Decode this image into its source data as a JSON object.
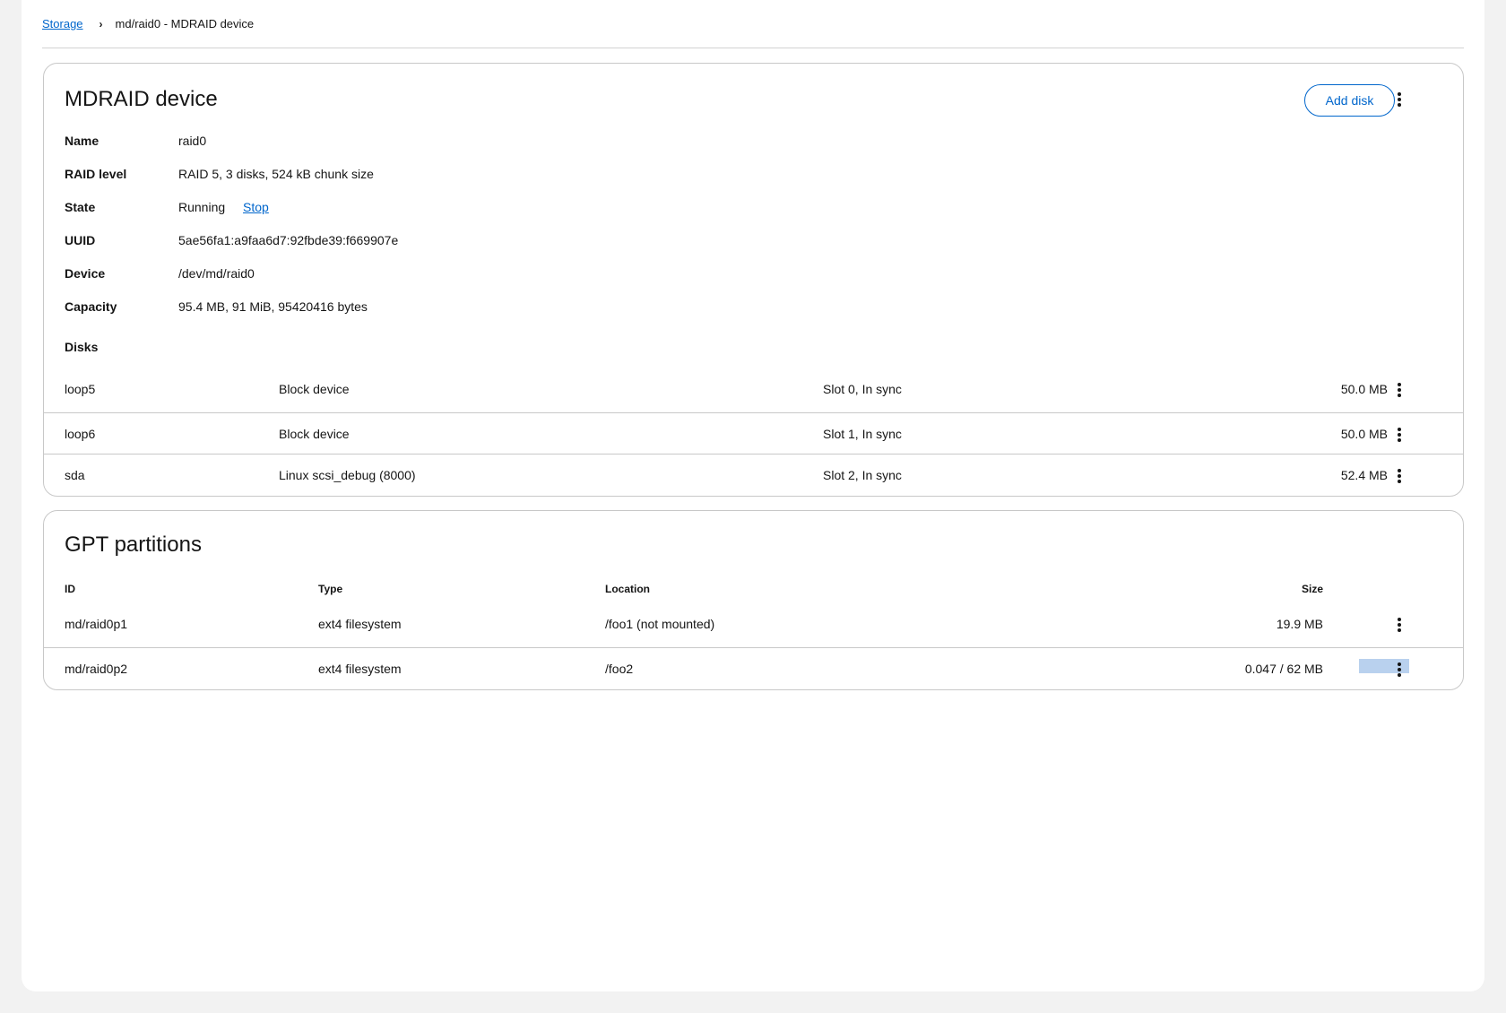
{
  "breadcrumb": {
    "root": "Storage",
    "separator": "›",
    "current": "md/raid0 - MDRAID device"
  },
  "mdraid": {
    "title": "MDRAID device",
    "add_disk_label": "Add disk",
    "details": [
      {
        "term": "Name",
        "value": "raid0"
      },
      {
        "term": "RAID level",
        "value": "RAID 5, 3 disks, 524 kB chunk size"
      },
      {
        "term": "State",
        "value": "Running",
        "action": "Stop"
      },
      {
        "term": "UUID",
        "value": "5ae56fa1:a9faa6d7:92fbde39:f669907e"
      },
      {
        "term": "Device",
        "value": "/dev/md/raid0"
      },
      {
        "term": "Capacity",
        "value": "95.4 MB, 91 MiB, 95420416 bytes"
      }
    ],
    "disks_label": "Disks",
    "disks": [
      {
        "name": "loop5",
        "type": "Block device",
        "slot": "Slot 0, In sync",
        "size": "50.0 MB"
      },
      {
        "name": "loop6",
        "type": "Block device",
        "slot": "Slot 1, In sync",
        "size": "50.0 MB"
      },
      {
        "name": "sda",
        "type": "Linux scsi_debug (8000)",
        "slot": "Slot 2, In sync",
        "size": "52.4 MB"
      }
    ]
  },
  "gpt": {
    "title": "GPT partitions",
    "headers": {
      "id": "ID",
      "type": "Type",
      "location": "Location",
      "size": "Size"
    },
    "partitions": [
      {
        "id": "md/raid0p1",
        "type": "ext4 filesystem",
        "location": "/foo1 (not mounted)",
        "size": "19.9 MB"
      },
      {
        "id": "md/raid0p2",
        "type": "ext4 filesystem",
        "location": "/foo2",
        "size": "0.047 / 62 MB",
        "usage_fraction": 0.001
      }
    ]
  },
  "colors": {
    "link": "#0066cc",
    "usage_bar": "#b9d1ee",
    "border": "#c8c8c8",
    "page_bg": "#f2f2f2"
  }
}
